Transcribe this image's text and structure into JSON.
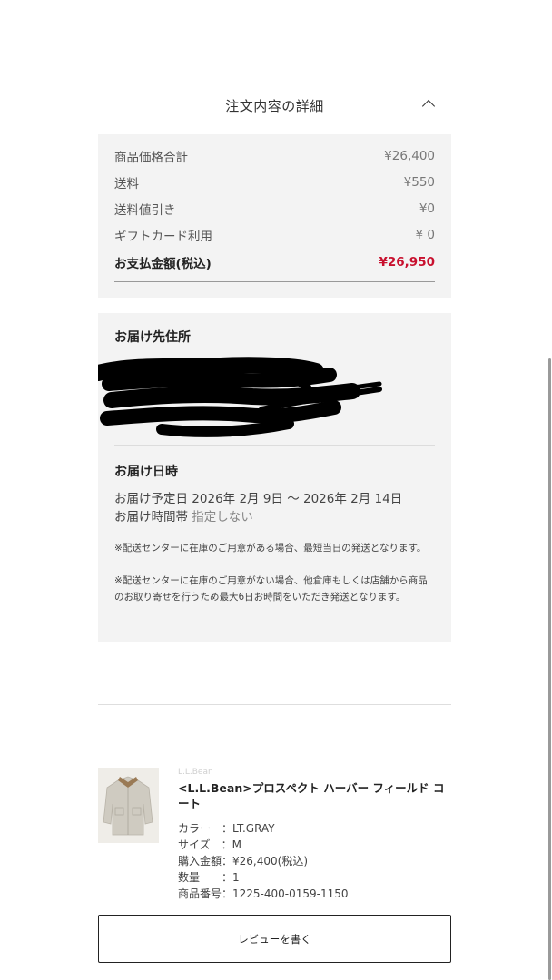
{
  "order_details": {
    "title": "注文内容の詳細",
    "collapse_icon": "chevron-up-icon"
  },
  "price_summary": {
    "rows": [
      {
        "label": "商品価格合計",
        "value": "¥26,400"
      },
      {
        "label": "送料",
        "value": "¥550"
      },
      {
        "label": "送料値引き",
        "value": "¥0"
      },
      {
        "label": "ギフトカード利用",
        "value": "¥ 0"
      }
    ],
    "total": {
      "label": "お支払金額(税込)",
      "value": "¥26,950"
    },
    "total_color": "#c8102e"
  },
  "delivery": {
    "address_heading": "お届け先住所",
    "date_heading": "お届け日時",
    "scheduled_label": "お届け予定日",
    "scheduled_value": "2026年 2月 9日 〜 2026年 2月 14日",
    "time_label": "お届け時間帯",
    "time_value": "指定しない",
    "note_1": "※配送センターに在庫のご用意がある場合、最短当日の発送となります。",
    "note_2": "※配送センターに在庫のご用意がない場合、他倉庫もしくは店舗から商品のお取り寄せを行うため最大6日お時間をいただき発送となります。"
  },
  "product": {
    "brand": "L.L.Bean",
    "name": "<L.L.Bean>プロスペクト ハーバー フィールド コート",
    "attributes": [
      {
        "key": "カラー　：",
        "value": "LT.GRAY"
      },
      {
        "key": "サイズ　：",
        "value": "M"
      },
      {
        "key": "購入金額：",
        "value": "¥26,400(税込)"
      },
      {
        "key": "数量　　：",
        "value": "1"
      },
      {
        "key": "商品番号：",
        "value": "1225-400-0159-1150"
      }
    ]
  },
  "review_button": {
    "label": "レビューを書く"
  }
}
